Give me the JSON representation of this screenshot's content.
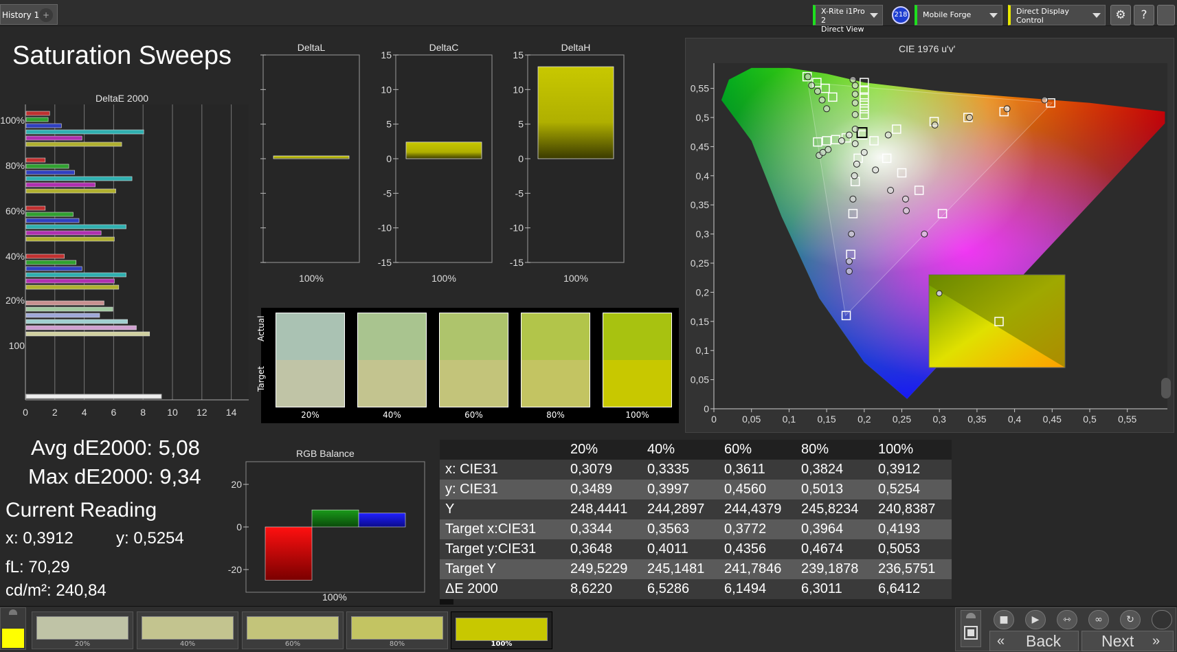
{
  "toolbar": {
    "tab_label": "History 1",
    "add_tab": "+",
    "meter_label_1": "X-Rite i1Pro 2",
    "meter_label_2": "Direct View",
    "badge": "218",
    "pattern_source": "Mobile Forge",
    "display_control": "Direct Display Control",
    "settings": "⚙",
    "help": "?"
  },
  "page": {
    "title": "Saturation Sweeps"
  },
  "deltae_chart": {
    "title": "DeltaE 2000",
    "y_labels": [
      "100%",
      "80%",
      "60%",
      "40%",
      "20%",
      "100"
    ],
    "x_ticks": [
      "0",
      "2",
      "4",
      "6",
      "8",
      "10",
      "12",
      "14"
    ]
  },
  "delta_panels": [
    {
      "title": "DeltaL",
      "x_label": "100%",
      "value": 0.4,
      "color": "#c8c800"
    },
    {
      "title": "DeltaC",
      "x_label": "100%",
      "value": 2.4,
      "color": "#c8c800"
    },
    {
      "title": "DeltaH",
      "x_label": "100%",
      "value": 13.3,
      "color": "#c8c800"
    }
  ],
  "delta_ticks": [
    "15",
    "10",
    "5",
    "0",
    "-5",
    "-10",
    "-15"
  ],
  "swatches": {
    "actual_label": "Actual",
    "target_label": "Target",
    "items": [
      {
        "label": "20%",
        "actual": "#aac2b3",
        "target": "#c0c4a6"
      },
      {
        "label": "40%",
        "actual": "#a9c48f",
        "target": "#c3c48f"
      },
      {
        "label": "60%",
        "actual": "#aec46c",
        "target": "#c3c47a"
      },
      {
        "label": "80%",
        "actual": "#b2c54a",
        "target": "#c3c462"
      },
      {
        "label": "100%",
        "actual": "#a8c210",
        "target": "#c8c800"
      }
    ]
  },
  "cie": {
    "title": "CIE 1976 u'v'",
    "y_ticks": [
      "0,55",
      "0,5",
      "0,45",
      "0,4",
      "0,35",
      "0,3",
      "0,25",
      "0,2",
      "0,15",
      "0,1",
      "0,05",
      "0"
    ],
    "x_ticks": [
      "0",
      "0,05",
      "0,1",
      "0,15",
      "0,2",
      "0,25",
      "0,3",
      "0,35",
      "0,4",
      "0,45",
      "0,5",
      "0,55"
    ]
  },
  "stats": {
    "avg": "Avg dE2000: 5,08",
    "max": "Max dE2000: 9,34",
    "current_reading": "Current Reading",
    "x": "x: 0,3912",
    "y": "y: 0,5254",
    "fl": "fL: 70,29",
    "cdm2": "cd/m²: 240,84"
  },
  "rgb_balance": {
    "title": "RGB Balance",
    "x_label": "100%",
    "y_ticks": [
      "20",
      "0",
      "-20"
    ],
    "values": {
      "red": -25,
      "green": 8,
      "blue": 6.5
    }
  },
  "table": {
    "headers": [
      "",
      "20%",
      "40%",
      "60%",
      "80%",
      "100%"
    ],
    "rows": [
      [
        "x: CIE31",
        "0,3079",
        "0,3335",
        "0,3611",
        "0,3824",
        "0,3912"
      ],
      [
        "y: CIE31",
        "0,3489",
        "0,3997",
        "0,4560",
        "0,5013",
        "0,5254"
      ],
      [
        "Y",
        "248,4441",
        "244,2897",
        "244,4379",
        "245,8234",
        "240,8387"
      ],
      [
        "Target x:CIE31",
        "0,3344",
        "0,3563",
        "0,3772",
        "0,3964",
        "0,4193"
      ],
      [
        "Target y:CIE31",
        "0,3648",
        "0,4011",
        "0,4356",
        "0,4674",
        "0,5053"
      ],
      [
        "Target Y",
        "249,5229",
        "245,1481",
        "241,7846",
        "239,1878",
        "236,5751"
      ],
      [
        "ΔE 2000",
        "8,6220",
        "6,5286",
        "6,1494",
        "6,3011",
        "6,6412"
      ]
    ]
  },
  "bottom": {
    "patches": [
      {
        "label": "20%",
        "color": "#bfc3a6"
      },
      {
        "label": "40%",
        "color": "#c3c48f"
      },
      {
        "label": "60%",
        "color": "#c3c47a"
      },
      {
        "label": "80%",
        "color": "#c3c462"
      },
      {
        "label": "100%",
        "color": "#c8c800"
      }
    ],
    "current_color": "#ffff00",
    "back": "Back",
    "next": "Next"
  }
}
